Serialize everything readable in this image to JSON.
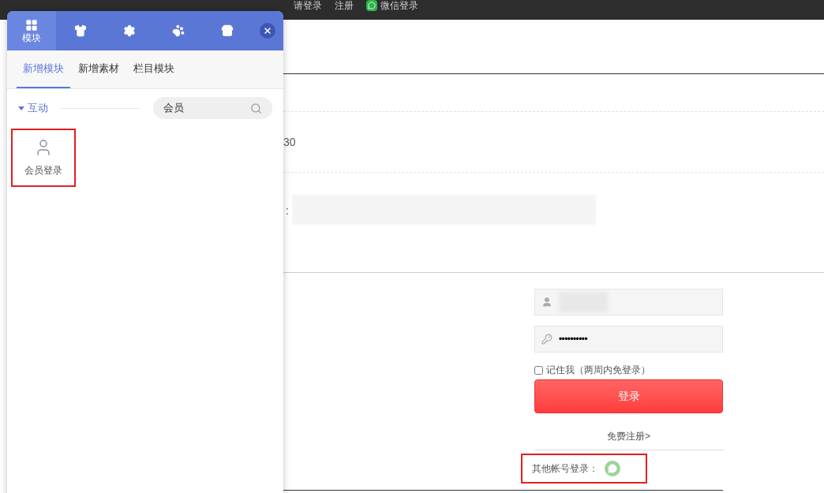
{
  "top_bar": {
    "links": [
      {
        "kind": "text",
        "label": "请登录"
      },
      {
        "kind": "text",
        "label": "注册"
      },
      {
        "kind": "wechat",
        "label": "微信登录"
      }
    ]
  },
  "page": {
    "value_text": "30",
    "label_fragment": ":"
  },
  "login": {
    "password": {
      "value": "••••••••••"
    },
    "remember": {
      "label": "记住我（两周内免登录）",
      "checked": false
    },
    "submit": "登录",
    "register": "免费注册>",
    "other_login": {
      "label": "其他帐号登录：",
      "highlighted": true
    }
  },
  "panel": {
    "top_tabs": [
      {
        "kind": "grid",
        "label": "模块",
        "selected": true
      },
      {
        "kind": "shirt",
        "selected": false
      },
      {
        "kind": "gear",
        "selected": false
      },
      {
        "kind": "paw",
        "selected": false
      },
      {
        "kind": "store",
        "selected": false
      }
    ],
    "sub_tabs": [
      {
        "label": "新增模块",
        "selected": true
      },
      {
        "label": "新增素材",
        "selected": false
      },
      {
        "label": "栏目模块",
        "selected": false
      }
    ],
    "category": {
      "label": "互动",
      "expanded": true
    },
    "search": {
      "value": "会员"
    },
    "modules": [
      {
        "label": "会员登录",
        "highlighted": true
      }
    ]
  }
}
